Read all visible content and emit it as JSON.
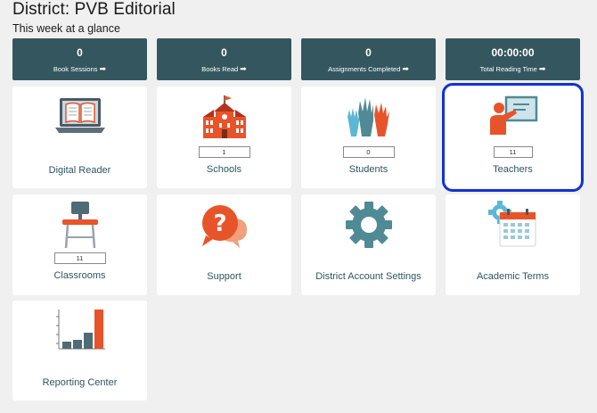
{
  "header": {
    "title": "District: PVB Editorial",
    "subtitle": "This week at a glance"
  },
  "stats": [
    {
      "value": "0",
      "label": "Book Sessions"
    },
    {
      "value": "0",
      "label": "Books Read"
    },
    {
      "value": "0",
      "label": "Assignments Completed"
    },
    {
      "value": "00:00:00",
      "label": "Total Reading Time"
    }
  ],
  "stat_arrow": "➡",
  "cards": {
    "digital_reader": {
      "label": "Digital Reader"
    },
    "schools": {
      "label": "Schools",
      "count": "1"
    },
    "students": {
      "label": "Students",
      "count": "0"
    },
    "teachers": {
      "label": "Teachers",
      "count": "11"
    },
    "classrooms": {
      "label": "Classrooms",
      "count": "11"
    },
    "support": {
      "label": "Support"
    },
    "district_settings": {
      "label": "District Account Settings"
    },
    "academic_terms": {
      "label": "Academic Terms"
    },
    "reporting_center": {
      "label": "Reporting Center"
    }
  },
  "icons": {
    "digital_reader": "laptop-book-icon",
    "schools": "school-building-icon",
    "students": "raised-hands-icon",
    "teachers": "teacher-board-icon",
    "classrooms": "school-desk-icon",
    "support": "question-bubble-icon",
    "district_settings": "gear-icon",
    "academic_terms": "calendar-gear-icon",
    "reporting_center": "bar-chart-icon"
  },
  "colors": {
    "stat_bg": "#34575f",
    "accent_orange": "#e8542a",
    "accent_teal": "#4f8a95",
    "selected_outline": "#1133d4",
    "card_label": "#2e5560"
  }
}
